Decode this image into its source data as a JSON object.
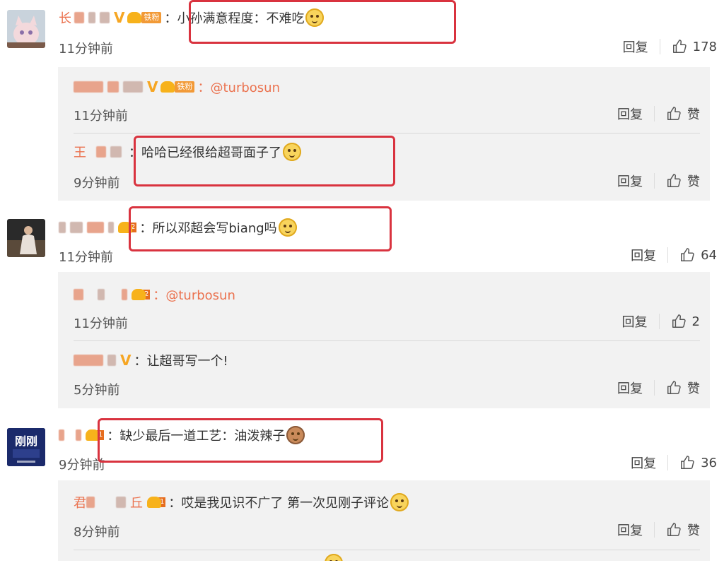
{
  "comments": [
    {
      "username": "长",
      "text": "：小孙满意程度：不难吃",
      "time": "11分钟前",
      "reply_label": "回复",
      "likes": "178",
      "replies": [
        {
          "text": "：@turbosun",
          "time": "11分钟前",
          "reply_label": "回复",
          "likes": "赞"
        },
        {
          "username": "王",
          "text": "哈哈已经很给超哥面子了",
          "time": "9分钟前",
          "reply_label": "回复",
          "likes": "赞"
        }
      ]
    },
    {
      "text": "：所以邓超会写biang吗",
      "time": "11分钟前",
      "reply_label": "回复",
      "likes": "64",
      "replies": [
        {
          "text": "：@turbosun",
          "time": "11分钟前",
          "reply_label": "回复",
          "likes": "2"
        },
        {
          "text": "：让超哥写一个!",
          "time": "5分钟前",
          "reply_label": "回复",
          "likes": "赞"
        }
      ]
    },
    {
      "avatar_text": "刚刚",
      "text": "：缺少最后一道工艺：油泼辣子",
      "time": "9分钟前",
      "reply_label": "回复",
      "likes": "36",
      "replies": [
        {
          "username": "君",
          "username2": "丘",
          "text": "：哎是我见识不广了 第一次见刚子评论",
          "time": "8分钟前",
          "reply_label": "回复",
          "likes": "赞"
        }
      ]
    }
  ],
  "badges": {
    "fan_label": "铁粉"
  },
  "colors": {
    "username": "#eb7350",
    "highlight_box": "#d9333f",
    "reply_bg": "#f2f2f2"
  }
}
